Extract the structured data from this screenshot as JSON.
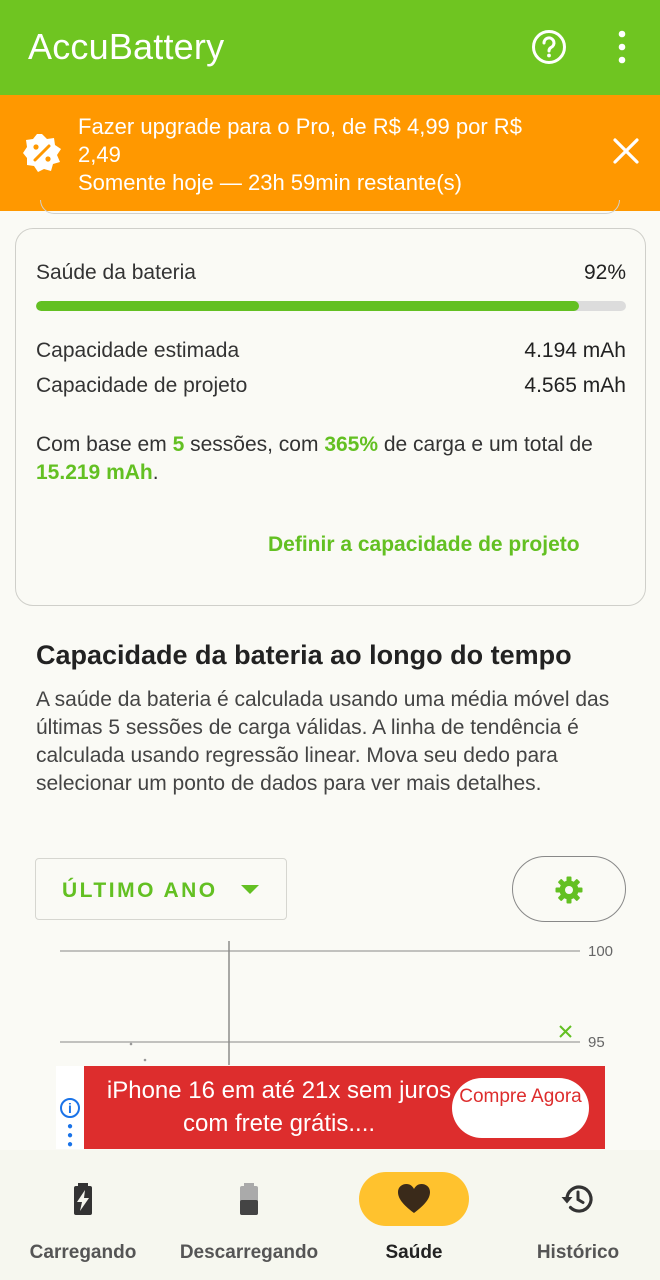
{
  "appbar": {
    "title": "AccuBattery",
    "icons": [
      "help-icon",
      "more-vert-icon"
    ]
  },
  "promo": {
    "line1": "Fazer upgrade para o Pro, de R$ 4,99 por R$ 2,49",
    "line2": "Somente hoje — 23h 59min restante(s)",
    "icons": [
      "discount-badge-icon",
      "close-icon"
    ]
  },
  "health_card": {
    "health_label": "Saúde da bateria",
    "health_value": "92%",
    "health_fraction": 0.92,
    "estimated_label": "Capacidade estimada",
    "estimated_value": "4.194 mAh",
    "design_label": "Capacidade de projeto",
    "design_value": "4.565 mAh",
    "basis_prefix": "Com base em ",
    "basis_sessions": "5",
    "basis_mid1": " sessões, com ",
    "basis_percent": "365%",
    "basis_mid2": " de carga e um total de ",
    "basis_total": "15.219 mAh",
    "basis_suffix": ".",
    "define_link": "Definir a capacidade de projeto"
  },
  "capacity_section": {
    "title": "Capacidade da bateria ao longo do tempo",
    "description": "A saúde da bateria é calculada usando uma média móvel das últimas 5 sessões de carga válidas. A linha de tendência é calculada usando regressão linear. Mova seu dedo para selecionar um ponto de dados para ver mais detalhes.",
    "range_selector": "ÚLTIMO ANO",
    "settings_icon": "gear-icon"
  },
  "chart_data": {
    "type": "scatter",
    "y_ticks": [
      "100",
      "95"
    ],
    "ylim": [
      95,
      100
    ],
    "points": [
      {
        "x": 1,
        "y": 95.5
      }
    ],
    "title": "",
    "xlabel": "",
    "ylabel": ""
  },
  "ad": {
    "text": "iPhone 16 em até 21x sem juros com frete grátis....",
    "cta": "Compre Agora",
    "icons": [
      "ad-info-icon"
    ]
  },
  "bottom_nav": {
    "items": [
      {
        "label": "Carregando",
        "icon": "battery-charging-icon"
      },
      {
        "label": "Descarregando",
        "icon": "battery-icon"
      },
      {
        "label": "Saúde",
        "icon": "heart-icon"
      },
      {
        "label": "Histórico",
        "icon": "history-icon"
      }
    ],
    "active_index": 2
  },
  "colors": {
    "brand_green": "#6fc521",
    "accent_green": "#63c022",
    "promo_orange": "#ff9800",
    "ad_red": "#dd2d2d",
    "active_pill": "#ffc22e"
  }
}
